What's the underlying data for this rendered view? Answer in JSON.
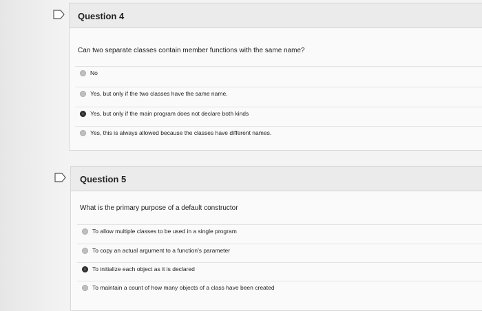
{
  "questions": [
    {
      "title": "Question 4",
      "prompt": "Can two separate classes contain member functions with the same name?",
      "answers": [
        {
          "label": "No",
          "selected": false
        },
        {
          "label": "Yes, but only if the two classes have the same name.",
          "selected": false
        },
        {
          "label": "Yes, but only if the main program does not declare both kinds",
          "selected": true
        },
        {
          "label": "Yes, this is always allowed because the classes have different names.",
          "selected": false
        }
      ]
    },
    {
      "title": "Question 5",
      "prompt": "What is the primary purpose of a default constructor",
      "answers": [
        {
          "label": "To allow multiple classes to be used in a single program",
          "selected": false
        },
        {
          "label": "To copy an actual argument to a function's parameter",
          "selected": false
        },
        {
          "label": "To initialize each object as it is declared",
          "selected": true
        },
        {
          "label": "To maintain a count of how many objects of a class have been created",
          "selected": false
        }
      ]
    }
  ],
  "icons": {
    "flag": "flag-icon",
    "radio": "radio-icon"
  },
  "colors": {
    "header_bg": "#ebebeb",
    "body_bg": "#fafafa",
    "selected_radio": "#333333"
  }
}
